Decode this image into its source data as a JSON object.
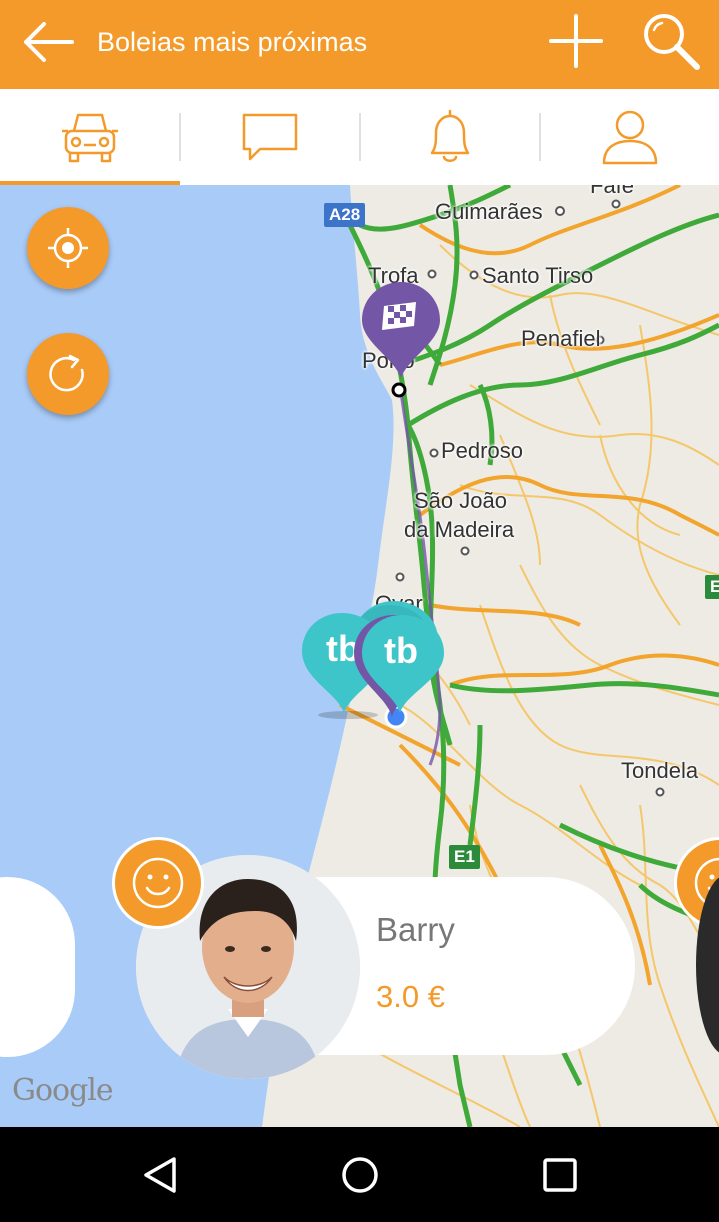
{
  "appbar": {
    "title": "Boleias mais próximas",
    "back_icon": "arrow-left-icon",
    "add_icon": "plus-icon",
    "search_icon": "search-icon",
    "color": "#F39A2B"
  },
  "tabs": [
    {
      "name": "rides",
      "icon": "car-icon",
      "selected": true
    },
    {
      "name": "messages",
      "icon": "chat-icon",
      "selected": false
    },
    {
      "name": "notifications",
      "icon": "bell-icon",
      "selected": false
    },
    {
      "name": "profile",
      "icon": "user-icon",
      "selected": false
    }
  ],
  "map": {
    "labels": {
      "guimaraes": "Guimarães",
      "trofa": "Trofa",
      "santo_tirso": "Santo Tirso",
      "penafiel": "Penafiel",
      "porto": "Porto",
      "pedroso": "Pedroso",
      "sao_joao": "São João",
      "da_madeira": "da Madeira",
      "ovar": "Ovar",
      "tondela": "Tondela",
      "fafe": "Fafe"
    },
    "road_shields": {
      "a28": "A28",
      "e1": "E1",
      "edge": "E"
    },
    "attribution": "Google",
    "pin_text": "tb",
    "colors": {
      "sea": "#A9CBF8",
      "land": "#EDEBE4",
      "highway": "#3FA93A",
      "major_road": "#F2A42C",
      "pin_teal": "#3EC5C9",
      "pin_purple": "#7456A7"
    }
  },
  "fabs": {
    "locate_icon": "crosshair-icon",
    "refresh_icon": "refresh-icon"
  },
  "card": {
    "driver_name": "Barry",
    "price": "3.0 €",
    "badge_icon": "smiley-icon"
  },
  "navbar": {
    "back_icon": "triangle-back-icon",
    "home_icon": "circle-home-icon",
    "recents_icon": "square-recents-icon"
  }
}
